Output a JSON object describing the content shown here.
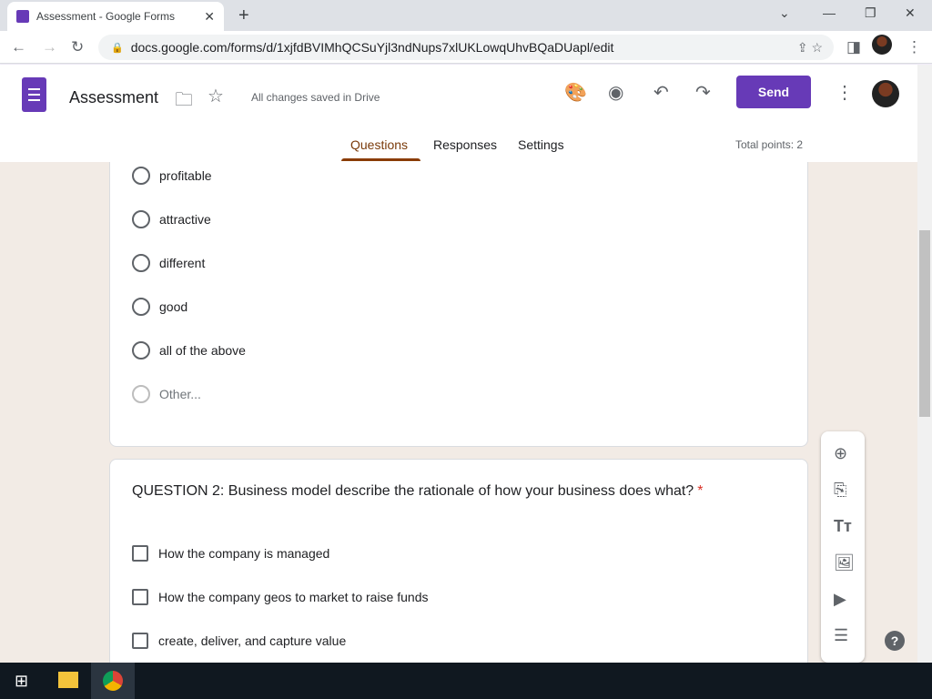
{
  "browser": {
    "tab_title": "Assessment - Google Forms",
    "url": "docs.google.com/forms/d/1xjfdBVIMhQCSuYjl3ndNups7xlUKLowqUhvBQaDUapl/edit"
  },
  "header": {
    "title": "Assessment",
    "saved_status": "All changes saved in Drive",
    "send_label": "Send",
    "tabs": [
      "Questions",
      "Responses",
      "Settings"
    ],
    "total_points": "Total points: 2"
  },
  "question1": {
    "options": [
      "profitable",
      "attractive",
      "different",
      "good",
      "all of the above",
      "Other..."
    ]
  },
  "question2": {
    "text": "QUESTION 2: Business model describe the rationale of how your business does what?",
    "required": "*",
    "options": [
      "How the company is managed",
      "How the company geos to market to raise funds",
      "create, deliver, and capture value"
    ]
  },
  "colors": {
    "accent": "#673ab7",
    "tab_underline": "#8a3c06"
  }
}
